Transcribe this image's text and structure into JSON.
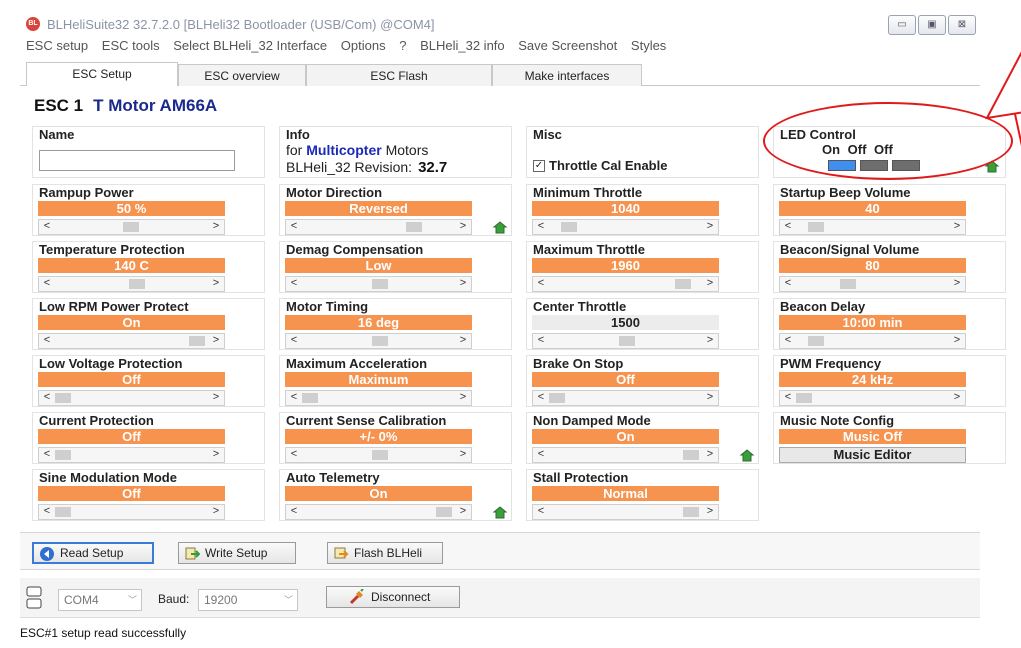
{
  "window": {
    "title": "BLHeliSuite32 32.7.2.0  [BLHeli32 Bootloader (USB/Com) @COM4]",
    "minimize": "▭",
    "maximize": "▣",
    "close": "⊠"
  },
  "menu": [
    "ESC setup",
    "ESC tools",
    "Select BLHeli_32 Interface",
    "Options",
    "?",
    "BLHeli_32 info",
    "Save Screenshot",
    "Styles"
  ],
  "tabs": [
    "ESC Setup",
    "ESC overview",
    "ESC Flash",
    "Make interfaces"
  ],
  "esc": {
    "id": "ESC 1",
    "motor": "T Motor AM66A"
  },
  "name_cell": {
    "label": "Name",
    "value": ""
  },
  "info_cell": {
    "label": "Info",
    "line1_prefix": "for",
    "line1_bold": "Multicopter",
    "line1_suffix": "Motors",
    "line2_prefix": "BLHeli_32 Revision:",
    "revision": "32.7"
  },
  "misc_cell": {
    "label": "Misc",
    "checkbox_label": "Throttle Cal Enable",
    "checked": true
  },
  "led_cell": {
    "label": "LED Control",
    "states": "On  Off  Off",
    "leds": [
      {
        "state": "On",
        "color": "#3f8ef0"
      },
      {
        "state": "Off",
        "color": "#6e6e6e"
      },
      {
        "state": "Off",
        "color": "#6e6e6e"
      }
    ]
  },
  "settings": {
    "rampup_power": {
      "label": "Rampup Power",
      "value": "50 %"
    },
    "motor_direction": {
      "label": "Motor Direction",
      "value": "Reversed"
    },
    "minimum_throttle": {
      "label": "Minimum Throttle",
      "value": "1040"
    },
    "startup_beep_volume": {
      "label": "Startup Beep Volume",
      "value": "40"
    },
    "temperature_protection": {
      "label": "Temperature Protection",
      "value": "140 C"
    },
    "demag_compensation": {
      "label": "Demag Compensation",
      "value": "Low"
    },
    "maximum_throttle": {
      "label": "Maximum Throttle",
      "value": "1960"
    },
    "beacon_signal_volume": {
      "label": "Beacon/Signal Volume",
      "value": "80"
    },
    "low_rpm_power_protect": {
      "label": "Low RPM Power Protect",
      "value": "On"
    },
    "motor_timing": {
      "label": "Motor Timing",
      "value": "16 deg"
    },
    "center_throttle": {
      "label": "Center Throttle",
      "value": "1500"
    },
    "beacon_delay": {
      "label": "Beacon Delay",
      "value": "10:00 min"
    },
    "low_voltage_protection": {
      "label": "Low Voltage Protection",
      "value": "Off"
    },
    "maximum_acceleration": {
      "label": "Maximum Acceleration",
      "value": "Maximum"
    },
    "brake_on_stop": {
      "label": "Brake On Stop",
      "value": "Off"
    },
    "pwm_frequency": {
      "label": "PWM Frequency",
      "value": "24 kHz"
    },
    "current_protection": {
      "label": "Current Protection",
      "value": "Off"
    },
    "current_sense_calibration": {
      "label": "Current Sense Calibration",
      "value": "+/- 0%"
    },
    "non_damped_mode": {
      "label": "Non Damped Mode",
      "value": "On"
    },
    "music_note_config": {
      "label": "Music Note Config",
      "value": "Music Off",
      "button": "Music Editor"
    },
    "sine_modulation_mode": {
      "label": "Sine Modulation Mode",
      "value": "Off"
    },
    "auto_telemetry": {
      "label": "Auto Telemetry",
      "value": "On"
    },
    "stall_protection": {
      "label": "Stall Protection",
      "value": "Normal"
    }
  },
  "buttons": {
    "read": "Read Setup",
    "write": "Write Setup",
    "flash": "Flash BLHeli"
  },
  "com": {
    "port": "COM4",
    "baud_label": "Baud:",
    "baud": "19200",
    "disconnect": "Disconnect"
  },
  "status": "ESC#1 setup read successfully",
  "colors": {
    "value_bar": "#f5934f",
    "accent": "#3a7bd5",
    "annotation": "#e01a1a"
  }
}
